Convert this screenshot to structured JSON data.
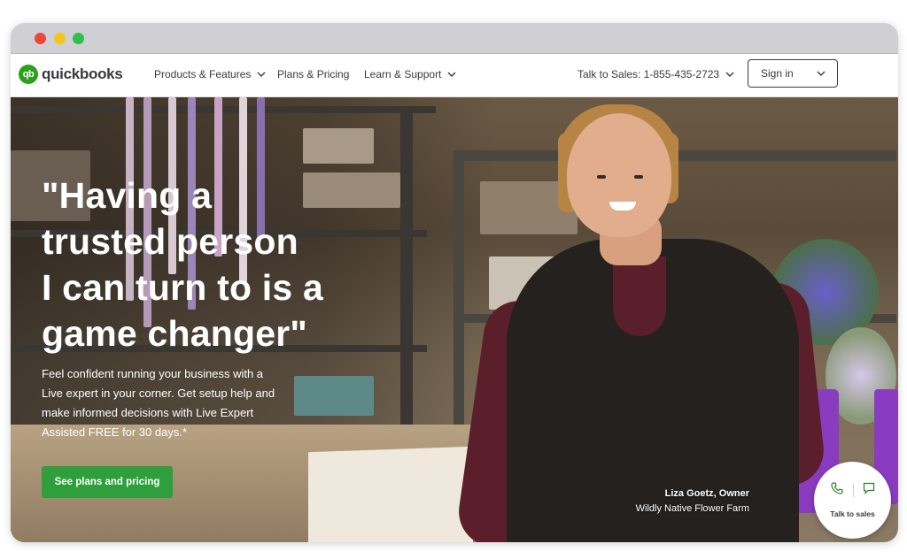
{
  "browser": {
    "controls": [
      "close",
      "minimize",
      "maximize"
    ]
  },
  "nav": {
    "logo_text": "quickbooks",
    "logo_mark": "qb",
    "items": [
      {
        "label": "Products & Features",
        "has_dropdown": true
      },
      {
        "label": "Plans & Pricing",
        "has_dropdown": false
      },
      {
        "label": "Learn & Support",
        "has_dropdown": true
      }
    ],
    "sales_label": "Talk to Sales: 1-855-435-2723",
    "signin_label": "Sign in"
  },
  "hero": {
    "headline_lines": [
      "\"Having a",
      "trusted person",
      "I can turn to is a",
      "game changer\""
    ],
    "subcopy_lines": [
      "Feel confident running your business with a",
      "Live expert in your corner. Get setup help and",
      "make informed decisions with Live Expert",
      "Assisted FREE for 30 days.*"
    ],
    "cta_label": "See plans and pricing",
    "caption_name": "Liza Goetz, Owner",
    "caption_business": "Wildly Native Flower Farm"
  },
  "talk_widget": {
    "label": "Talk to sales",
    "icons": [
      "phone-icon",
      "chat-icon"
    ]
  },
  "colors": {
    "brand_green": "#2ca01c",
    "cta_green": "#2e9f3c",
    "text_dark": "#393a3d"
  }
}
